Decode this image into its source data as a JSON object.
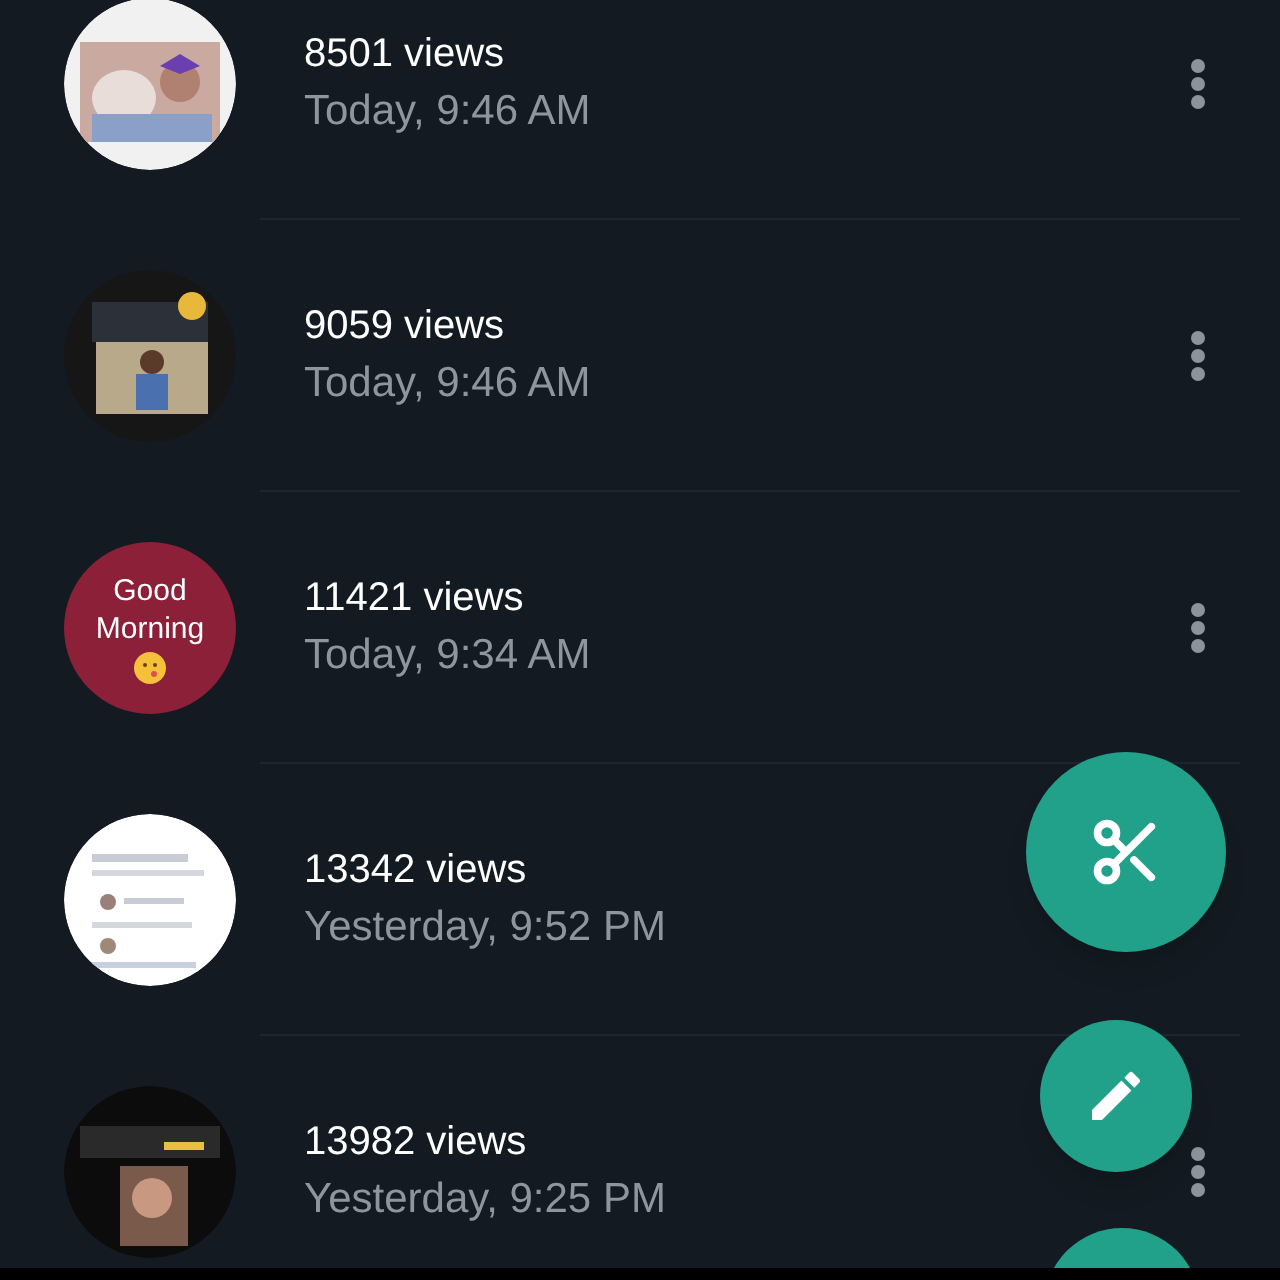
{
  "statuses": [
    {
      "views": "8501 views",
      "time": "Today, 9:46 AM",
      "menu": true
    },
    {
      "views": "9059 views",
      "time": "Today, 9:46 AM",
      "menu": true
    },
    {
      "thumbnail": {
        "kind": "text",
        "text": "Good Morning",
        "color": "#8b2038"
      },
      "views": "11421 views",
      "time": "Today, 9:34 AM",
      "menu": true
    },
    {
      "views": "13342 views",
      "time": "Yesterday, 9:52 PM",
      "menu": false
    },
    {
      "views": "13982 views",
      "time": "Yesterday, 9:25 PM",
      "menu": true
    }
  ]
}
